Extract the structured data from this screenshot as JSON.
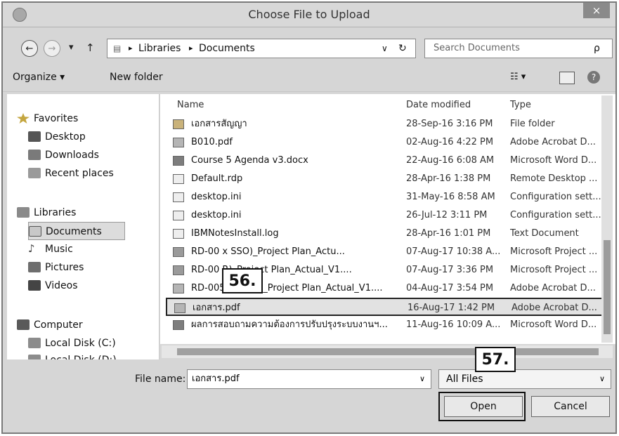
{
  "window": {
    "title": "Choose File to Upload",
    "close_glyph": "×"
  },
  "address_bar": {
    "back_glyph": "←",
    "forward_glyph": "→",
    "recent_glyph": "▾",
    "up_glyph": "↑",
    "breadcrumb": [
      "Libraries",
      "Documents"
    ],
    "separator": "▸",
    "dropdown_glyph": "∨",
    "refresh_glyph": "↻",
    "search_placeholder": "Search Documents",
    "search_glyph": "ρ"
  },
  "toolbar": {
    "organize": "Organize ▾",
    "new_folder": "New folder",
    "view_glyph": "☷ ▾",
    "help_glyph": "?"
  },
  "nav": {
    "groups": [
      {
        "label": "Favorites",
        "icon": "star-icon",
        "children": [
          {
            "label": "Desktop",
            "icon": "desktop-icon"
          },
          {
            "label": "Downloads",
            "icon": "downloads-icon"
          },
          {
            "label": "Recent places",
            "icon": "recent-places-icon"
          }
        ]
      },
      {
        "label": "Libraries",
        "icon": "libraries-icon",
        "children": [
          {
            "label": "Documents",
            "icon": "documents-icon",
            "selected": true
          },
          {
            "label": "Music",
            "icon": "music-icon"
          },
          {
            "label": "Pictures",
            "icon": "pictures-icon"
          },
          {
            "label": "Videos",
            "icon": "videos-icon"
          }
        ]
      },
      {
        "label": "Computer",
        "icon": "computer-icon",
        "children": [
          {
            "label": "Local Disk (C:)",
            "icon": "disk-icon"
          },
          {
            "label": "Local Disk (D:)",
            "icon": "disk-icon"
          }
        ]
      }
    ]
  },
  "columns": {
    "name": "Name",
    "date": "Date modified",
    "type": "Type"
  },
  "files": [
    {
      "name": "เอกสารสัญญา",
      "date": "28-Sep-16 3:16 PM",
      "type": "File folder",
      "icon": "folder-icon"
    },
    {
      "name": "B010.pdf",
      "date": "02-Aug-16 4:22 PM",
      "type": "Adobe Acrobat D...",
      "icon": "pdf-icon"
    },
    {
      "name": "Course 5 Agenda v3.docx",
      "date": "22-Aug-16 6:08 AM",
      "type": "Microsoft Word D...",
      "icon": "word-icon"
    },
    {
      "name": "Default.rdp",
      "date": "28-Apr-16 1:38 PM",
      "type": "Remote Desktop ...",
      "icon": "rdp-icon"
    },
    {
      "name": "desktop.ini",
      "date": "31-May-16 8:58 AM",
      "type": "Configuration sett...",
      "icon": "ini-icon"
    },
    {
      "name": "desktop.ini",
      "date": "26-Jul-12 3:11 PM",
      "type": "Configuration sett...",
      "icon": "ini-icon"
    },
    {
      "name": "IBMNotesInstall.log",
      "date": "28-Apr-16 1:01 PM",
      "type": "Text Document",
      "icon": "text-icon"
    },
    {
      "name": "RD-00 x SSO)_Project Plan_Actu...",
      "date": "07-Aug-17 10:38 A...",
      "type": "Microsoft Project ...",
      "icon": "project-icon"
    },
    {
      "name": "RD-00 R)_Project Plan_Actual_V1....",
      "date": "07-Aug-17 3:36 PM",
      "type": "Microsoft Project ...",
      "icon": "project-icon"
    },
    {
      "name": "RD-005 58 (HR)_Project Plan_Actual_V1....",
      "date": "04-Aug-17 3:54 PM",
      "type": "Adobe Acrobat D...",
      "icon": "pdf-icon"
    },
    {
      "name": "เอกสาร.pdf",
      "date": "16-Aug-17 1:42 PM",
      "type": "Adobe Acrobat D...",
      "icon": "pdf-icon",
      "selected": true
    },
    {
      "name": "ผลการสอบถามความต้องการปรับปรุงระบบงานฯ...",
      "date": "11-Aug-16 10:09 A...",
      "type": "Microsoft Word D...",
      "icon": "word-icon"
    }
  ],
  "bottom": {
    "file_name_label": "File name:",
    "file_name_value": "เอกสาร.pdf",
    "filter_value": "All Files",
    "open_label": "Open",
    "cancel_label": "Cancel"
  },
  "annotations": {
    "callout_56": "56.",
    "callout_57": "57."
  },
  "colors": {
    "selection": "#e2e2e2",
    "dialog_bg": "#d6d6d6"
  }
}
